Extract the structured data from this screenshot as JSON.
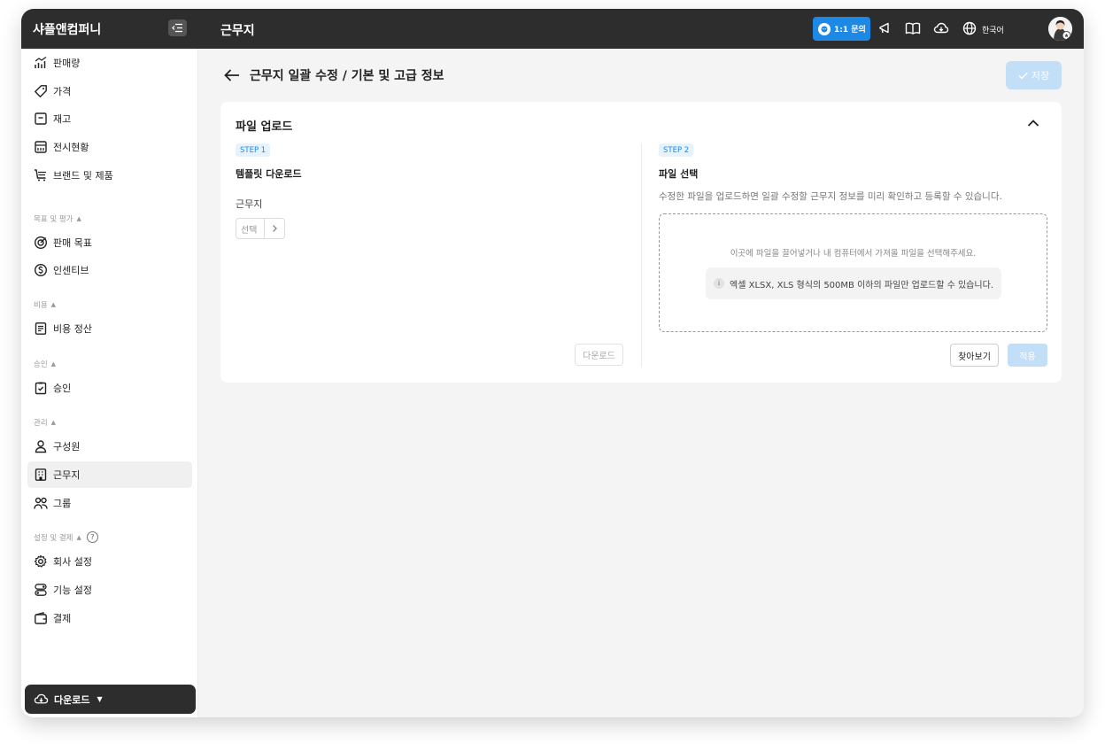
{
  "company": "샤플앤컴퍼니",
  "header": {
    "page_name": "근무지",
    "inquiry_label": "1:1 문의",
    "language": "한국어"
  },
  "sidebar": {
    "items": [
      {
        "label": "판매량",
        "icon": "chart-icon"
      },
      {
        "label": "가격",
        "icon": "tag-icon"
      },
      {
        "label": "재고",
        "icon": "box-icon"
      },
      {
        "label": "전시현황",
        "icon": "display-icon"
      },
      {
        "label": "브랜드 및 제품",
        "icon": "cart-icon"
      },
      {
        "label": "판매 목표",
        "icon": "target-icon"
      },
      {
        "label": "인센티브",
        "icon": "coin-icon"
      },
      {
        "label": "비용 정산",
        "icon": "receipt-icon"
      },
      {
        "label": "승인",
        "icon": "clipboard-check-icon"
      },
      {
        "label": "구성원",
        "icon": "user-icon"
      },
      {
        "label": "근무지",
        "icon": "building-icon"
      },
      {
        "label": "그룹",
        "icon": "users-icon"
      },
      {
        "label": "회사 설정",
        "icon": "gear-icon"
      },
      {
        "label": "기능 설정",
        "icon": "toggle-icon"
      },
      {
        "label": "결제",
        "icon": "wallet-icon"
      }
    ],
    "sections": {
      "goals": "목표 및 평가",
      "cost": "비용",
      "approval": "승인",
      "manage": "관리",
      "settings": "설정 및 결제"
    },
    "download_label": "다운로드"
  },
  "main": {
    "title": "근무지 일괄 수정 / 기본 및 고급 정보",
    "save_label": "저장",
    "card": {
      "title": "파일 업로드",
      "step1": {
        "badge": "STEP 1",
        "title": "템플릿 다운로드",
        "field_label": "근무지",
        "select_placeholder": "선택",
        "download_button": "다운로드"
      },
      "step2": {
        "badge": "STEP 2",
        "title": "파일 선택",
        "description": "수정한 파일을 업로드하면 일괄 수정할 근무지 정보를 미리 확인하고 등록할 수 있습니다.",
        "dropzone_text": "이곳에 파일을 끌어넣거나 내 컴퓨터에서 가져올 파일을 선택해주세요.",
        "info_text": "엑셀 XLSX, XLS 형식의 500MB 이하의 파일만 업로드할 수 있습니다.",
        "browse_button": "찾아보기",
        "apply_button": "적용"
      }
    }
  },
  "colors": {
    "topbar": "#2d2d2d",
    "accent": "#1e88e5",
    "disabled_accent": "#c3def7"
  }
}
